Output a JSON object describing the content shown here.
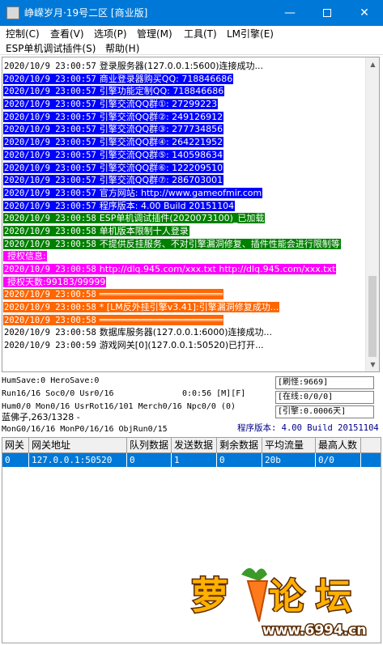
{
  "window": {
    "title": "峥嵘岁月·19号二区 [商业版]",
    "minimize_glyph": "—",
    "close_glyph": "✕"
  },
  "menu": {
    "row1": [
      "控制(C)",
      "查看(V)",
      "选项(P)",
      "管理(M)",
      "工具(T)",
      "LM引擎(E)"
    ],
    "row2": [
      "ESP单机调试插件(S)",
      "帮助(H)"
    ]
  },
  "log": [
    {
      "ts": "2020/10/9 23:00:57",
      "msg": "登录服务器(127.0.0.1:5600)连接成功...",
      "fg": "#000000",
      "bg": "#ffffff"
    },
    {
      "ts": "2020/10/9 23:00:57",
      "msg": "商业登录器购买QQ: 718846686",
      "fg": "#ffffff",
      "bg": "#0000ff"
    },
    {
      "ts": "2020/10/9 23:00:57",
      "msg": "引擎功能定制QQ: 718846686",
      "fg": "#ffffff",
      "bg": "#0000ff"
    },
    {
      "ts": "2020/10/9 23:00:57",
      "msg": "引擎交流QQ群①: 27299223",
      "fg": "#ffffff",
      "bg": "#0000ff"
    },
    {
      "ts": "2020/10/9 23:00:57",
      "msg": "引擎交流QQ群②: 249126912",
      "fg": "#ffffff",
      "bg": "#0000ff"
    },
    {
      "ts": "2020/10/9 23:00:57",
      "msg": "引擎交流QQ群③: 277734856",
      "fg": "#ffffff",
      "bg": "#0000ff"
    },
    {
      "ts": "2020/10/9 23:00:57",
      "msg": "引擎交流QQ群④: 264221952",
      "fg": "#ffffff",
      "bg": "#0000ff"
    },
    {
      "ts": "2020/10/9 23:00:57",
      "msg": "引擎交流QQ群⑤: 140598634",
      "fg": "#ffffff",
      "bg": "#0000ff"
    },
    {
      "ts": "2020/10/9 23:00:57",
      "msg": "引擎交流QQ群⑥: 122209510",
      "fg": "#ffffff",
      "bg": "#0000ff"
    },
    {
      "ts": "2020/10/9 23:00:57",
      "msg": "引擎交流QQ群⑦: 286703001",
      "fg": "#ffffff",
      "bg": "#0000ff"
    },
    {
      "ts": "2020/10/9 23:00:57",
      "msg": "官方网站: http://www.gameofmir.com",
      "fg": "#ffffff",
      "bg": "#0000ff"
    },
    {
      "ts": "2020/10/9 23:00:57",
      "msg": "程序版本: 4.00 Build 20151104",
      "fg": "#ffffff",
      "bg": "#0000ff"
    },
    {
      "ts": "2020/10/9 23:00:58",
      "msg": "ESP单机调试插件(2020073100)_已加载",
      "fg": "#ffffff",
      "bg": "#008000"
    },
    {
      "ts": "2020/10/9 23:00:58",
      "msg": "单机版本限制十人登录",
      "fg": "#ffffff",
      "bg": "#008000"
    },
    {
      "ts": "2020/10/9 23:00:58",
      "msg": "不提供反挂服务、不对引擎漏洞修复、插件性能会进行限制等",
      "fg": "#ffffff",
      "bg": "#008000"
    },
    {
      "ts": "",
      "msg": "授权信息:",
      "fg": "#ffffff",
      "bg": "#ff00ff"
    },
    {
      "ts": "2020/10/9 23:00:58",
      "msg": "http://dlq.945.com/xxx.txt http://dlq.945.com/xxx.txt",
      "fg": "#ffffff",
      "bg": "#ff00ff"
    },
    {
      "ts": "",
      "msg": "授权天数:99183/99999",
      "fg": "#ffffff",
      "bg": "#ff00ff"
    },
    {
      "ts": "2020/10/9 23:00:58",
      "msg": "═══════════════════════",
      "fg": "#ffffff",
      "bg": "#ff6600"
    },
    {
      "ts": "2020/10/9 23:00:58",
      "msg": "* [LM反外挂引擎v3.41]:引擎漏洞修复成功...",
      "fg": "#ffffff",
      "bg": "#ff6600"
    },
    {
      "ts": "2020/10/9 23:00:58",
      "msg": "═══════════════════════",
      "fg": "#ffffff",
      "bg": "#ff6600"
    },
    {
      "ts": "2020/10/9 23:00:58",
      "msg": "数据库服务器(127.0.0.1:6000)连接成功...",
      "fg": "#000000",
      "bg": "#ffffff"
    },
    {
      "ts": "2020/10/9 23:00:59",
      "msg": "游戏网关[0](127.0.0.1:50520)已打开...",
      "fg": "#000000",
      "bg": "#ffffff"
    }
  ],
  "status": {
    "line1": "HumSave:0 HeroSave:0",
    "line2": "Run16/16 Soc0/0 Usr0/16",
    "time": "0:0:56 [M][F]",
    "line3": "Hum0/0 Mon0/16 UsrRot16/101 Merch0/16 Npc0/0 (0)",
    "player": "蓝佛子,263/1328 -",
    "line5": "MonG0/16/16 MonP0/16/16 ObjRun0/15",
    "box_refresh": "[刷怪:9669]",
    "box_online": "[在线:0/0/0]",
    "box_engine": "[引擎:0.0006天]",
    "version": "程序版本: 4.00 Build 20151104"
  },
  "grid": {
    "headers": [
      "网关",
      "网关地址",
      "队列数据",
      "发送数据",
      "剩余数据",
      "平均流量",
      "最高人数"
    ],
    "rows": [
      [
        "0",
        "127.0.0.1:50520",
        "0",
        "1",
        "0",
        "20b",
        "0/0"
      ]
    ]
  },
  "watermark": {
    "brand": "萝卜论坛",
    "url": "www.6994.cn"
  }
}
